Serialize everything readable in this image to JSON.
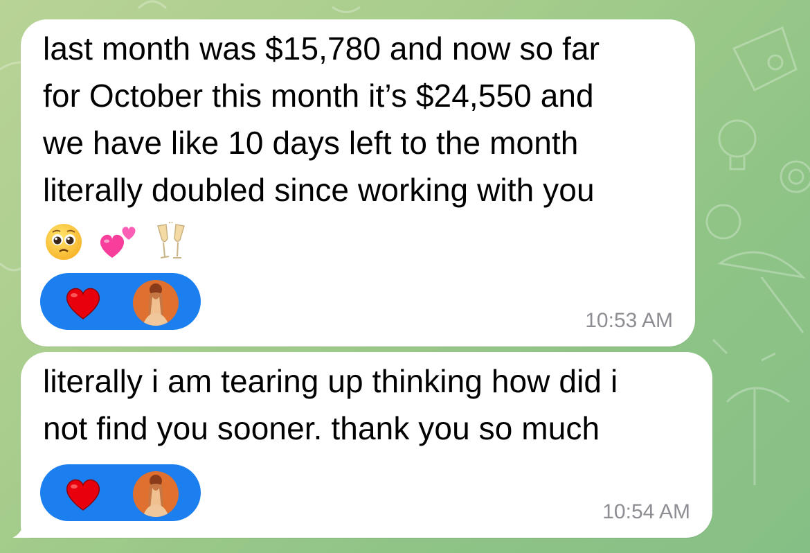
{
  "messages": [
    {
      "text": "last month was $15,780 and now so far\nfor October this month it’s $24,550 and\nwe have like 10 days left to the month\nliterally doubled since working with you",
      "emojis": [
        "pleading-face",
        "two-hearts",
        "clinking-glasses"
      ],
      "reaction": "heart",
      "time": "10:53 AM"
    },
    {
      "text": "literally i am tearing up thinking how did i\nnot find you sooner. thank you so much",
      "reaction": "heart",
      "time": "10:54 AM"
    }
  ],
  "colors": {
    "reaction_pill": "#1c7ff0",
    "bubble": "#ffffff",
    "timestamp": "#8d8d93",
    "heart": "#e8000d"
  }
}
